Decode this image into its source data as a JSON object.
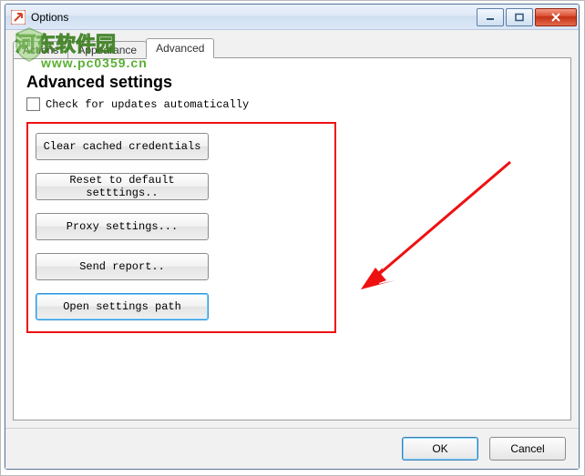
{
  "window": {
    "title": "Options",
    "sysbuttons": {
      "min": "minimize",
      "max": "maximize",
      "close": "close"
    }
  },
  "tabs": {
    "items": [
      {
        "label": "Actions",
        "active": false
      },
      {
        "label": "Appearance",
        "active": false
      },
      {
        "label": "Advanced",
        "active": true
      }
    ]
  },
  "advanced": {
    "heading": "Advanced settings",
    "check_updates_label": "Check for updates automatically",
    "check_updates_checked": false,
    "buttons": [
      "Clear cached credentials",
      "Reset to default setttings..",
      "Proxy settings...",
      "Send report..",
      "Open settings path"
    ],
    "focused_button_index": 4
  },
  "dialog": {
    "ok": "OK",
    "cancel": "Cancel"
  },
  "watermark": {
    "text": "河东软件园",
    "url": "www.pc0359.cn"
  },
  "annotation": {
    "highlight_color": "#ee1111",
    "arrow_color": "#ee1111"
  }
}
